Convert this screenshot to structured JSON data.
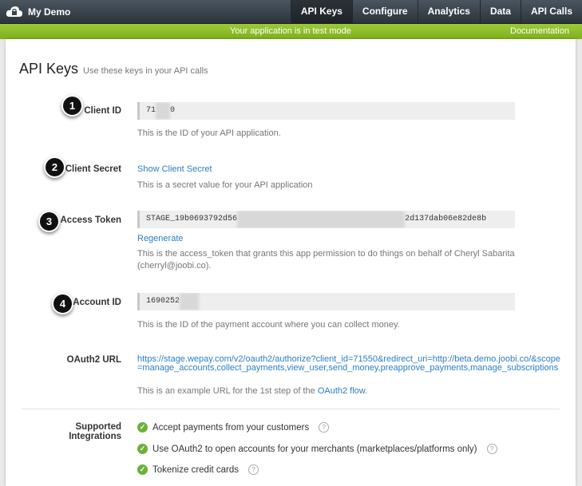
{
  "header": {
    "app_name": "My Demo",
    "nav": [
      "API Keys",
      "Configure",
      "Analytics",
      "Data",
      "API Calls"
    ],
    "active_nav": "API Keys"
  },
  "subbar": {
    "message": "Your application is in test mode",
    "documentation": "Documentation"
  },
  "page": {
    "title": "API Keys",
    "subtitle": "Use these keys in your API calls"
  },
  "client_id": {
    "badge": "1",
    "label": "Client ID",
    "value_start": "71",
    "value_end": "0",
    "help": "This is the ID of your API application."
  },
  "client_secret": {
    "badge": "2",
    "label": "Client Secret",
    "link": "Show Client Secret",
    "help": "This is a secret value for your API application"
  },
  "access_token": {
    "badge": "3",
    "label": "Access Token",
    "value_start": "STAGE_19b0693792d56",
    "value_end": "2d137dab06e82de8b",
    "link": "Regenerate",
    "help": "This is the access_token that grants this app permission to do things on behalf of Cheryl Sabarita (cherryl@joobi.co)."
  },
  "account_id": {
    "badge": "4",
    "label": "Account ID",
    "value_start": "1690252",
    "help": "This is the ID of the payment account where you can collect money."
  },
  "oauth2": {
    "label": "OAuth2 URL",
    "url": "https://stage.wepay.com/v2/oauth2/authorize?client_id=71550&redirect_uri=http://beta.demo.joobi.co/&scope=manage_accounts,collect_payments,view_user,send_money,preapprove_payments,manage_subscriptions",
    "help_prefix": "This is an example URL for the 1st step of the ",
    "help_link": "OAuth2 flow",
    "help_suffix": "."
  },
  "integrations": {
    "label": "Supported Integrations",
    "items": [
      "Accept payments from your customers",
      "Use OAuth2 to open accounts for your merchants (marketplaces/platforms only)",
      "Tokenize credit cards"
    ]
  },
  "colors": {
    "accent": "#2a7fc4",
    "test_mode_bar": "#8bbd28",
    "check": "#6ab23a"
  }
}
